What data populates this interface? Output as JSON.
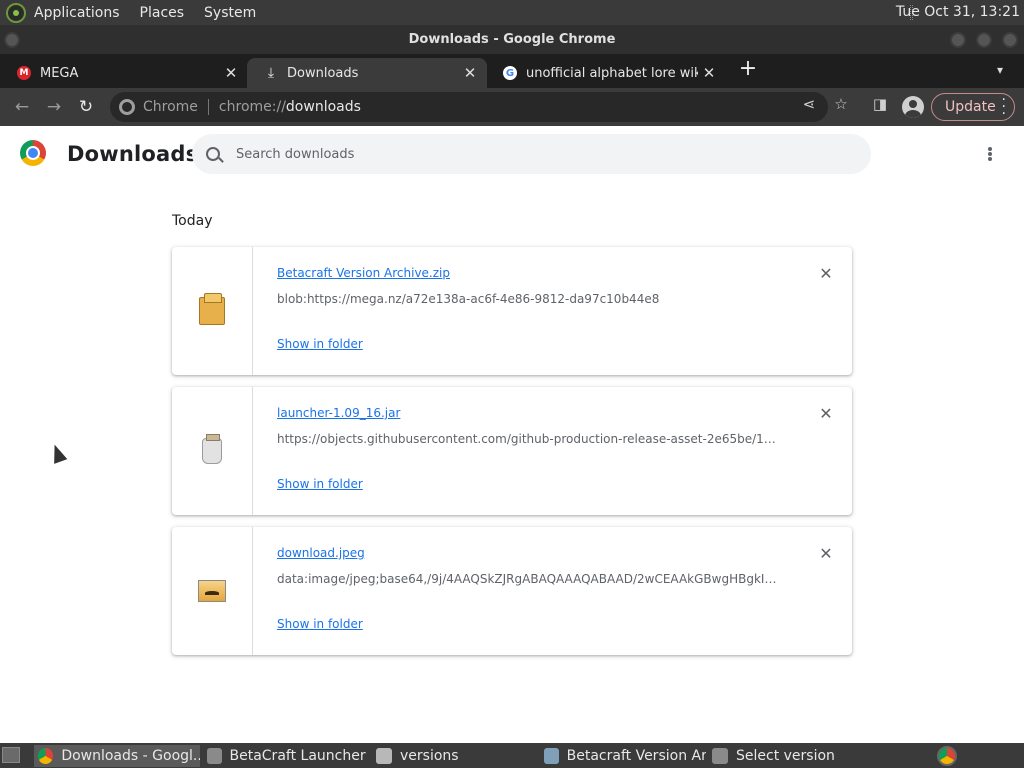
{
  "os_panel": {
    "menus": [
      "Applications",
      "Places",
      "System"
    ],
    "clock": "Tue Oct 31, 13:21"
  },
  "window": {
    "title": "Downloads - Google Chrome"
  },
  "tabs": [
    {
      "label": "MEGA",
      "icon": "mega-icon",
      "active": false
    },
    {
      "label": "Downloads",
      "icon": "download-icon",
      "active": true
    },
    {
      "label": "unofficial alphabet lore wiki - G",
      "icon": "google-icon",
      "active": false
    }
  ],
  "toolbar": {
    "site_chip": "Chrome",
    "url_scheme": "chrome://",
    "url_host": "downloads",
    "update_label": "Update"
  },
  "page": {
    "title": "Downloads",
    "search_placeholder": "Search downloads",
    "section": "Today",
    "downloads": [
      {
        "name": "Betacraft Version Archive.zip",
        "url": "blob:https://mega.nz/a72e138a-ac6f-4e86-9812-da97c10b44e8",
        "action": "Show in folder",
        "icon": "zip-archive-icon"
      },
      {
        "name": "launcher-1.09_16.jar",
        "url": "https://objects.githubusercontent.com/github-production-release-asset-2e65be/157...",
        "action": "Show in folder",
        "icon": "jar-file-icon"
      },
      {
        "name": "download.jpeg",
        "url": "data:image/jpeg;base64,/9j/4AAQSkZJRgABAQAAAQABAAD/2wCEAAkGBwgHBgkIB...",
        "action": "Show in folder",
        "icon": "image-file-icon"
      }
    ]
  },
  "taskbar": {
    "items": [
      {
        "label": "Downloads - Googl...",
        "active": true
      },
      {
        "label": "BetaCraft Launcher ...",
        "active": false
      },
      {
        "label": "versions",
        "active": false
      },
      {
        "label": "Betacraft Version Ar...",
        "active": false
      },
      {
        "label": "Select version",
        "active": false
      }
    ]
  },
  "colors": {
    "link": "#1a73e8",
    "update_accent": "#c58a8a",
    "chrome_frame": "#3b3b3b"
  }
}
